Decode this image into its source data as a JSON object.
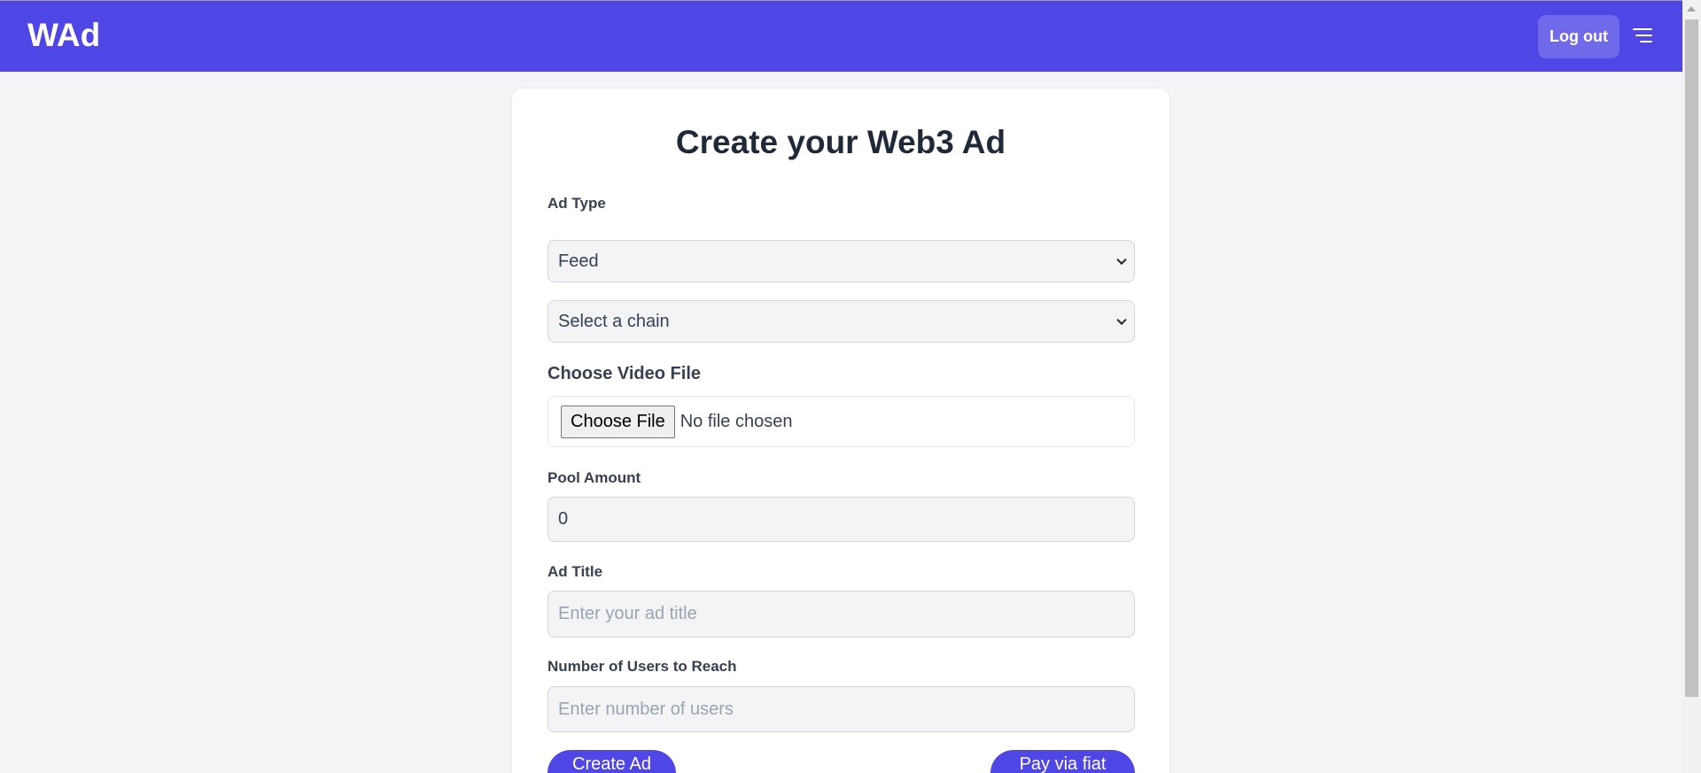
{
  "header": {
    "logo": "WAd",
    "logout_label": "Log out",
    "menu_icon": "hamburger-icon",
    "color": "#4f46e5"
  },
  "form": {
    "title": "Create your Web3 Ad",
    "ad_type_label": "Ad Type",
    "ad_type_value": "Feed",
    "chain_value": "Select a chain",
    "video_label": "Choose Video File",
    "file_button": "Choose File",
    "file_status": "No file chosen",
    "pool_label": "Pool Amount",
    "pool_value": "0",
    "title_label": "Ad Title",
    "title_placeholder": "Enter your ad title",
    "users_label": "Number of Users to Reach",
    "users_placeholder": "Enter number of users",
    "create_button": "Create Ad",
    "fiat_button": "Pay via fiat"
  }
}
